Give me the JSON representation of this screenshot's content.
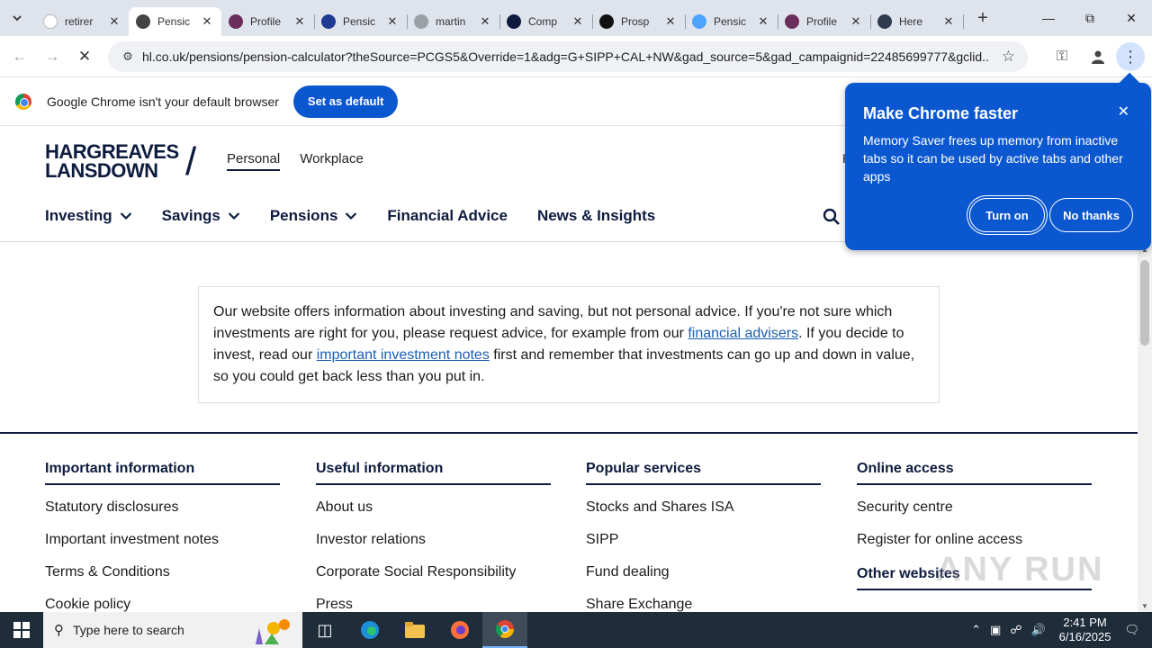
{
  "browser": {
    "tabs": [
      {
        "title": "retirer",
        "favicon": "blank-page-icon",
        "color": "#ffffff",
        "active": false
      },
      {
        "title": "Pensic",
        "favicon": "hl-favicon",
        "color": "#444444",
        "active": true
      },
      {
        "title": "Profile",
        "favicon": "p-favicon",
        "color": "#6b2d5c",
        "active": false
      },
      {
        "title": "Pensic",
        "favicon": "grid-favicon",
        "color": "#1f3a93",
        "active": false
      },
      {
        "title": "martin",
        "favicon": "link-favicon",
        "color": "#9aa0a6",
        "active": false
      },
      {
        "title": "Comp",
        "favicon": "circle-favicon",
        "color": "#0d1b3e",
        "active": false
      },
      {
        "title": "Prosp",
        "favicon": "f-favicon",
        "color": "#111111",
        "active": false
      },
      {
        "title": "Pensic",
        "favicon": "ring-favicon",
        "color": "#4da3ff",
        "active": false
      },
      {
        "title": "Profile",
        "favicon": "p-favicon",
        "color": "#6b2d5c",
        "active": false
      },
      {
        "title": "Here",
        "favicon": "gg-favicon",
        "color": "#2f3b4f",
        "active": false
      }
    ],
    "url": "hl.co.uk/pensions/pension-calculator?theSource=PCGS5&Override=1&adg=G+SIPP+CAL+NW&gad_source=5&gad_campaignid=22485699777&gclid...",
    "infobar": {
      "message": "Google Chrome isn't your default browser",
      "button": "Set as default"
    }
  },
  "popup": {
    "title": "Make Chrome faster",
    "body": "Memory Saver frees up memory from inactive tabs so it can be used by active tabs and other apps",
    "primary": "Turn on",
    "secondary": "No thanks"
  },
  "site": {
    "logo_line1": "HARGREAVES",
    "logo_line2": "LANSDOWN",
    "audience": [
      "Personal",
      "Workplace"
    ],
    "header_right": "R",
    "nav": [
      {
        "label": "Investing",
        "dropdown": true
      },
      {
        "label": "Savings",
        "dropdown": true
      },
      {
        "label": "Pensions",
        "dropdown": true
      },
      {
        "label": "Financial Advice",
        "dropdown": false
      },
      {
        "label": "News & Insights",
        "dropdown": false
      }
    ],
    "disclaimer": {
      "part1": "Our website offers information about investing and saving, but not personal advice. If you're not sure which investments are right for you, please request advice, for example from our ",
      "link1": "financial advisers",
      "part2": ". If you decide to invest, read our ",
      "link2": "important investment notes",
      "part3": " first and remember that investments can go up and down in value, so you could get back less than you put in."
    },
    "footer": [
      {
        "heading": "Important information",
        "links": [
          "Statutory disclosures",
          "Important investment notes",
          "Terms & Conditions",
          "Cookie policy"
        ]
      },
      {
        "heading": "Useful information",
        "links": [
          "About us",
          "Investor relations",
          "Corporate Social Responsibility",
          "Press"
        ]
      },
      {
        "heading": "Popular services",
        "links": [
          "Stocks and Shares ISA",
          "SIPP",
          "Fund dealing",
          "Share Exchange"
        ]
      },
      {
        "heading": "Online access",
        "links": [
          "Security centre",
          "Register for online access"
        ],
        "subheading": "Other websites"
      }
    ]
  },
  "watermark": "ANY RUN",
  "taskbar": {
    "search_placeholder": "Type here to search",
    "time": "2:41 PM",
    "date": "6/16/2025"
  }
}
